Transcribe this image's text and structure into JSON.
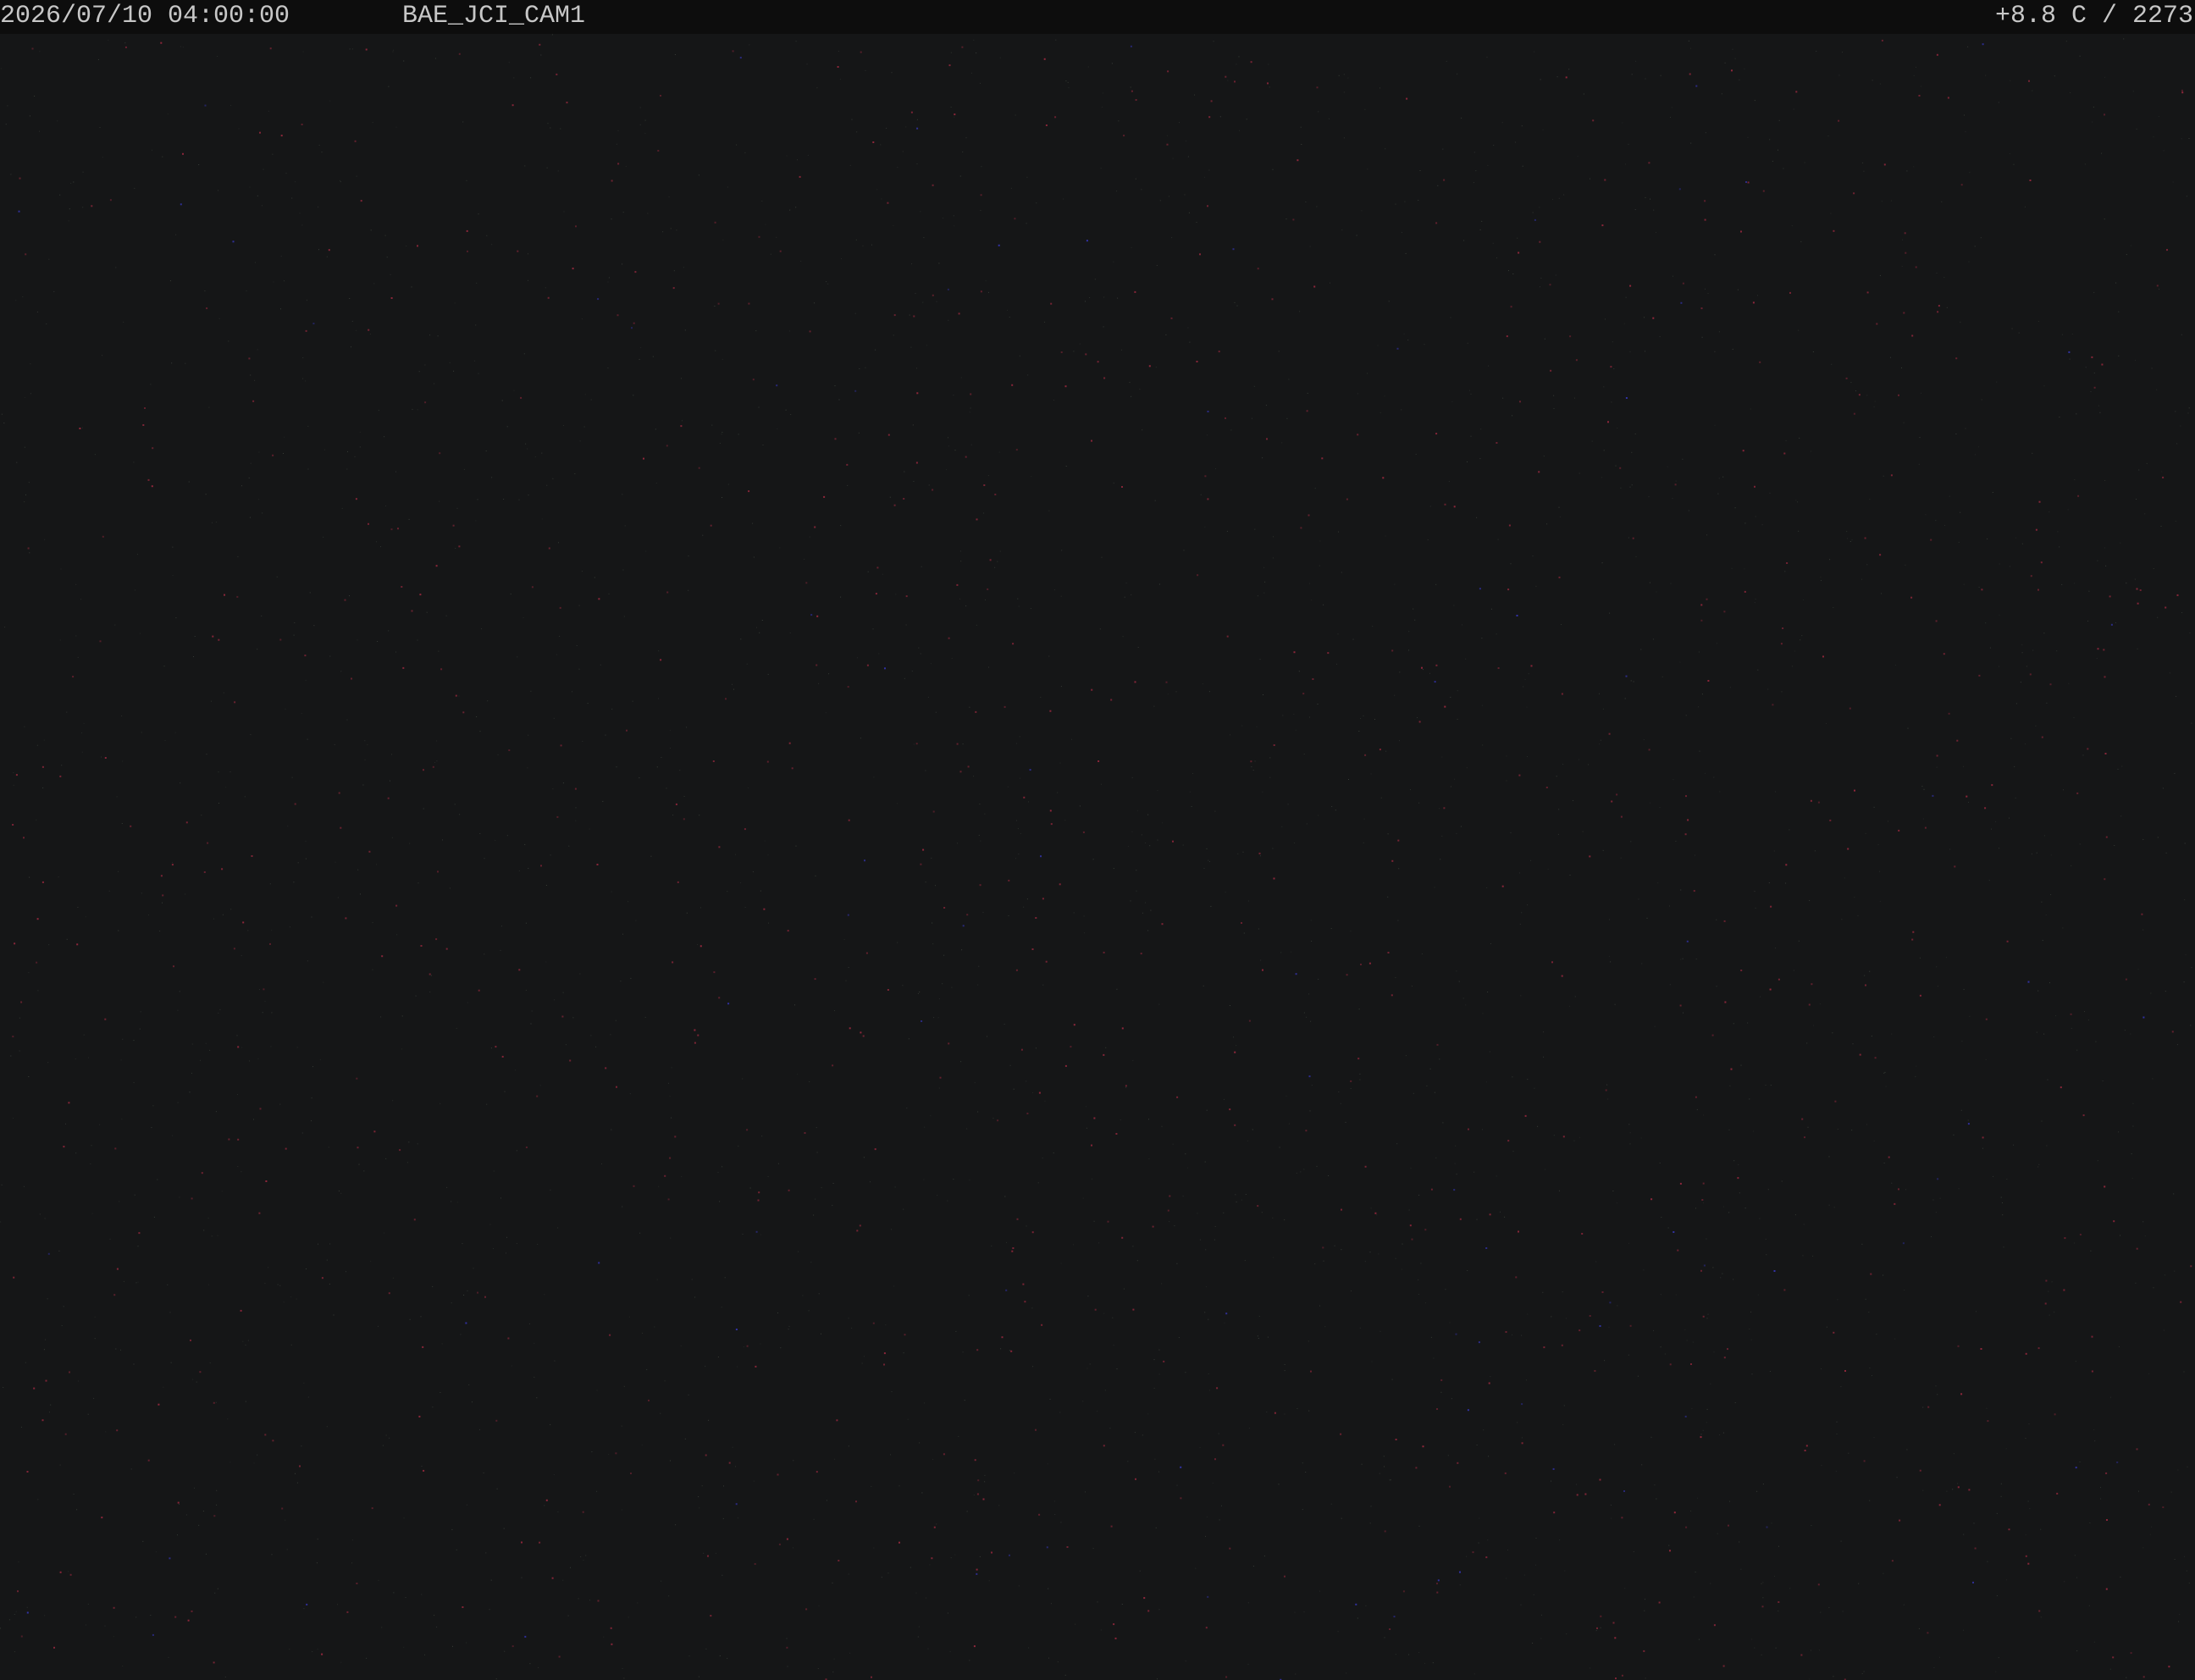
{
  "overlay": {
    "datetime": "2026/07/10  04:00:00",
    "camera_name": "BAE_JCI_CAM1",
    "temperature_status": "+8.8 C / 2273"
  },
  "colors": {
    "background": "#151617",
    "overlay_bar": "#0d0d0d",
    "overlay_text": "#c7c7c7",
    "noise_red": "#b02c45",
    "noise_blue": "#3b3bd0",
    "noise_gray": "#4a5148"
  }
}
